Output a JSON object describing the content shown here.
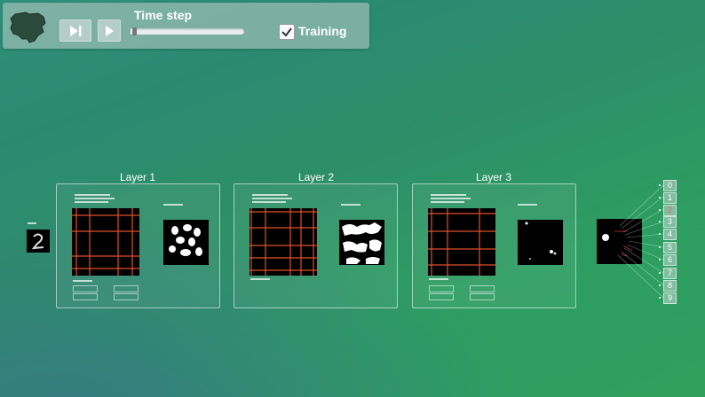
{
  "controls": {
    "timestep_label": "Time step",
    "training_label": "Training",
    "training_checked": true,
    "timestep_progress": 0.03
  },
  "layers": [
    {
      "title": "Layer 1"
    },
    {
      "title": "Layer 2"
    },
    {
      "title": "Layer 3"
    }
  ],
  "outputs": {
    "digits": [
      "0",
      "1",
      "2",
      "3",
      "4",
      "5",
      "6",
      "7",
      "8",
      "9"
    ],
    "active_digit": "2"
  },
  "colors": {
    "accent_grid": "#e0502a",
    "panel_border": "#ffffff"
  }
}
